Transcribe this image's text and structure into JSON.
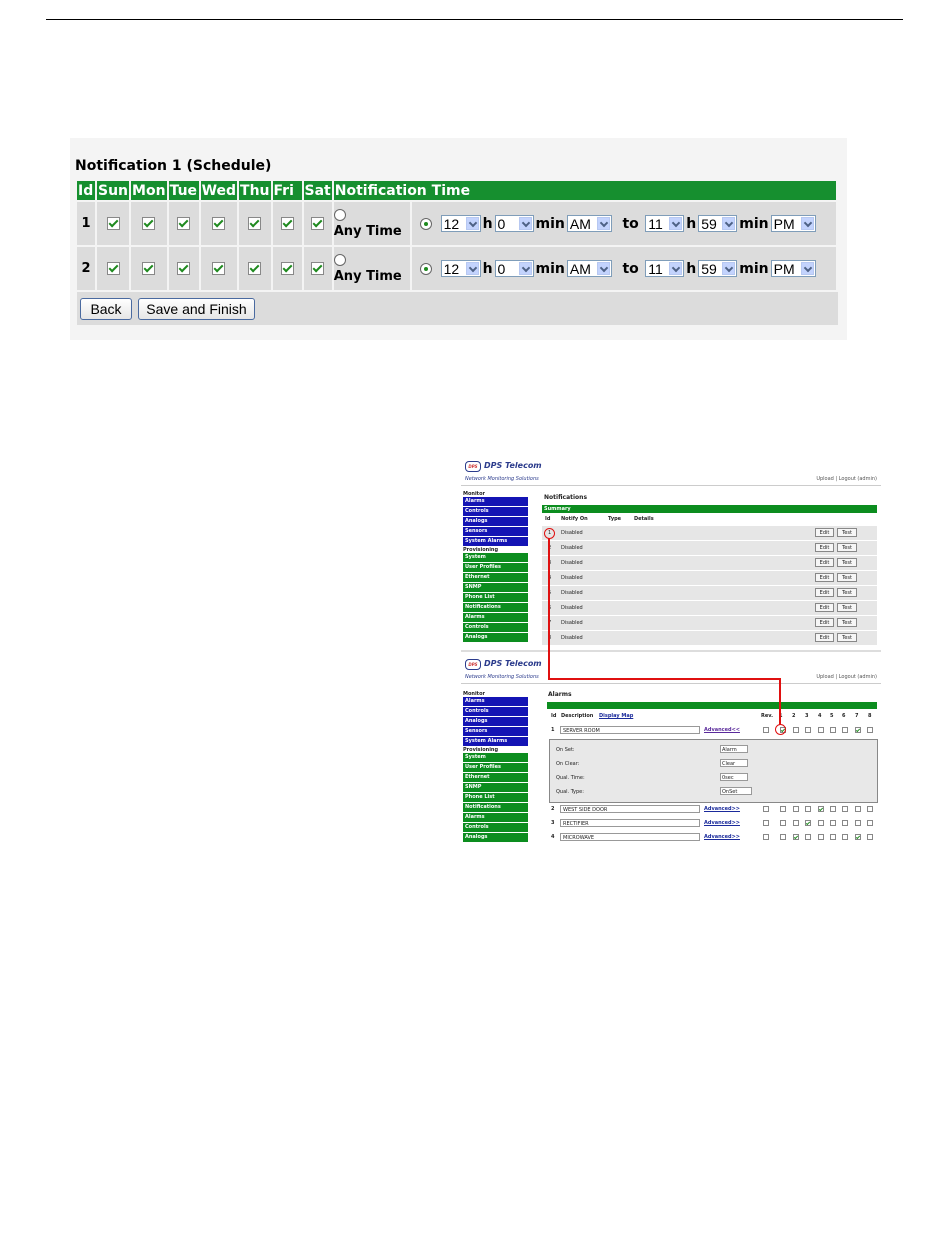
{
  "schedule": {
    "title": "Notification 1 (Schedule)",
    "headers": [
      "Id",
      "Sun",
      "Mon",
      "Tue",
      "Wed",
      "Thu",
      "Fri",
      "Sat",
      "Notification Time"
    ],
    "rows": [
      {
        "id": "1",
        "any_time": "Any Time",
        "from_h": "12",
        "h": "h",
        "from_min": "0",
        "min": "min",
        "from_ampm": "AM",
        "to": "to",
        "to_h": "11",
        "to_min": "59",
        "to_ampm": "PM"
      },
      {
        "id": "2",
        "any_time": "Any Time",
        "from_h": "12",
        "h": "h",
        "from_min": "0",
        "min": "min",
        "from_ampm": "AM",
        "to": "to",
        "to_h": "11",
        "to_min": "59",
        "to_ampm": "PM"
      }
    ],
    "back_label": "Back",
    "save_label": "Save and Finish"
  },
  "screenshot": {
    "brand": "DPS Telecom",
    "logo_mark": "DPS",
    "tagline": "Network Monitoring Solutions",
    "upload_logout": "Upload | Logout (admin)",
    "nav": {
      "monitor_label": "Monitor",
      "monitor_items": [
        "Alarms",
        "Controls",
        "Analogs",
        "Sensors",
        "System Alarms"
      ],
      "provisioning_label": "Provisioning",
      "prov_items_top": [
        "System",
        "User Profiles",
        "Ethernet",
        "SNMP",
        "Phone List",
        "Notifications",
        "Alarms",
        "Controls",
        "Analogs"
      ],
      "prov_items_bottom": [
        "System",
        "User Profiles",
        "Ethernet",
        "SNMP",
        "Phone List",
        "Notifications",
        "Alarms",
        "Controls",
        "Analogs"
      ]
    },
    "notifications": {
      "title": "Notifications",
      "summary": "Summary",
      "cols": [
        "Id",
        "Notify On",
        "Type",
        "Details"
      ],
      "row_ids": [
        "1",
        "2",
        "3",
        "4",
        "5",
        "6",
        "7",
        "8"
      ],
      "status": "Disabled",
      "edit": "Edit",
      "test": "Test"
    },
    "alarms": {
      "title": "Alarms",
      "col_id": "Id",
      "col_desc": "Description",
      "display_map": "Display Map",
      "rev": "Rev.",
      "notif_cols": [
        "1",
        "2",
        "3",
        "4",
        "5",
        "6",
        "7",
        "8"
      ],
      "rows": [
        {
          "id": "1",
          "desc": "SERVER ROOM",
          "adv": "Advanced<<"
        },
        {
          "id": "2",
          "desc": "WEST SIDE DOOR",
          "adv": "Advanced>>"
        },
        {
          "id": "3",
          "desc": "RECTIFIER",
          "adv": "Advanced>>"
        },
        {
          "id": "4",
          "desc": "MICROWAVE",
          "adv": "Advanced>>"
        }
      ],
      "adv_fields": [
        {
          "label": "On Set:",
          "value": "Alarm"
        },
        {
          "label": "On Clear:",
          "value": "Clear"
        },
        {
          "label": "Qual. Time:",
          "value": "0sec"
        },
        {
          "label": "Qual. Type:",
          "value": "OnSet"
        }
      ]
    }
  }
}
